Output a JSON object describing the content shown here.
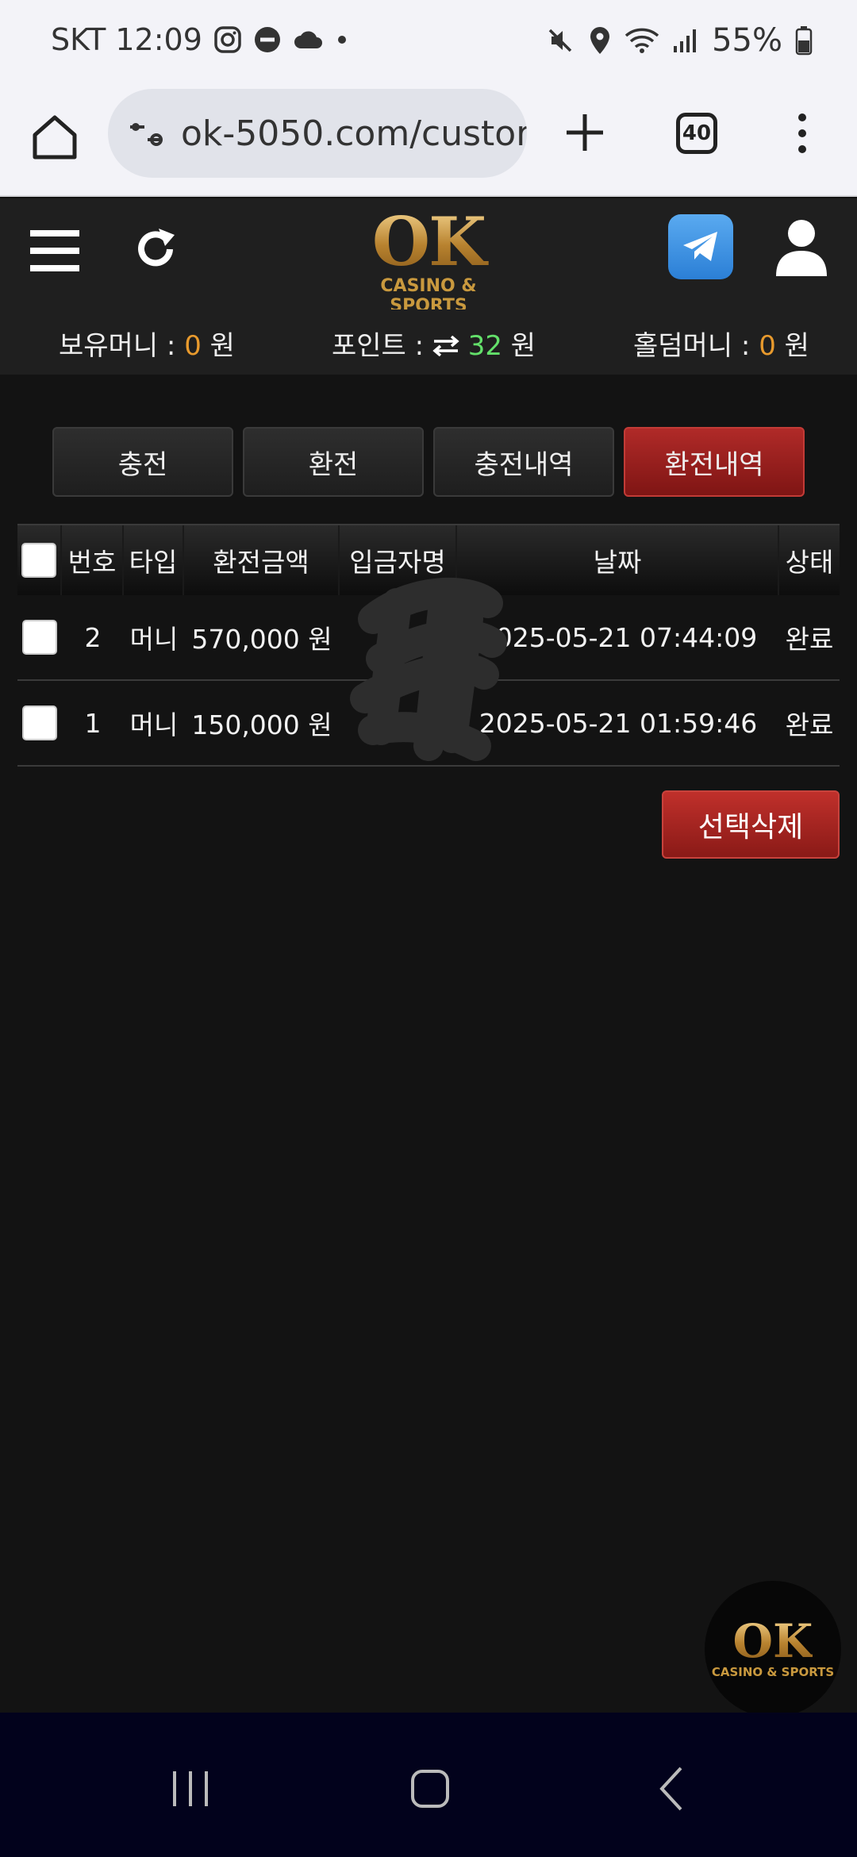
{
  "status_bar": {
    "carrier_time": "SKT 12:09",
    "battery": "55%",
    "icons_left": [
      "instagram-icon",
      "do-not-disturb-icon",
      "cloud-icon",
      "dot-icon"
    ],
    "icons_right": [
      "mute-icon",
      "location-icon",
      "wifi-icon",
      "signal-icon",
      "battery-icon"
    ]
  },
  "browser": {
    "url": "ok-5050.com/custor",
    "tab_count": "40"
  },
  "header": {
    "logo_main": "OK",
    "logo_sub": "CASINO & SPORTS"
  },
  "balance": {
    "money_label": "보유머니 : ",
    "money_value": "0",
    "money_unit": " 원",
    "point_label": "포인트 : ",
    "point_value": "32",
    "point_unit": " 원",
    "holdem_label": "홀덤머니 : ",
    "holdem_value": "0",
    "holdem_unit": " 원"
  },
  "tabs": [
    {
      "label": "충전",
      "active": false
    },
    {
      "label": "환전",
      "active": false
    },
    {
      "label": "충전내역",
      "active": false
    },
    {
      "label": "환전내역",
      "active": true
    }
  ],
  "table": {
    "headers": {
      "no": "번호",
      "type": "타입",
      "amount": "환전금액",
      "depositor": "입금자명",
      "date": "날짜",
      "status": "상태"
    },
    "rows": [
      {
        "no": "2",
        "type": "머니",
        "amount": "570,000 원",
        "depositor": "",
        "date": "2025-05-21 07:44:09",
        "status": "완료"
      },
      {
        "no": "1",
        "type": "머니",
        "amount": "150,000 원",
        "depositor": "",
        "date": "2025-05-21 01:59:46",
        "status": "완료"
      }
    ]
  },
  "delete_button": "선택삭제",
  "floating_logo": {
    "main": "OK",
    "sub": "CASINO & SPORTS"
  }
}
